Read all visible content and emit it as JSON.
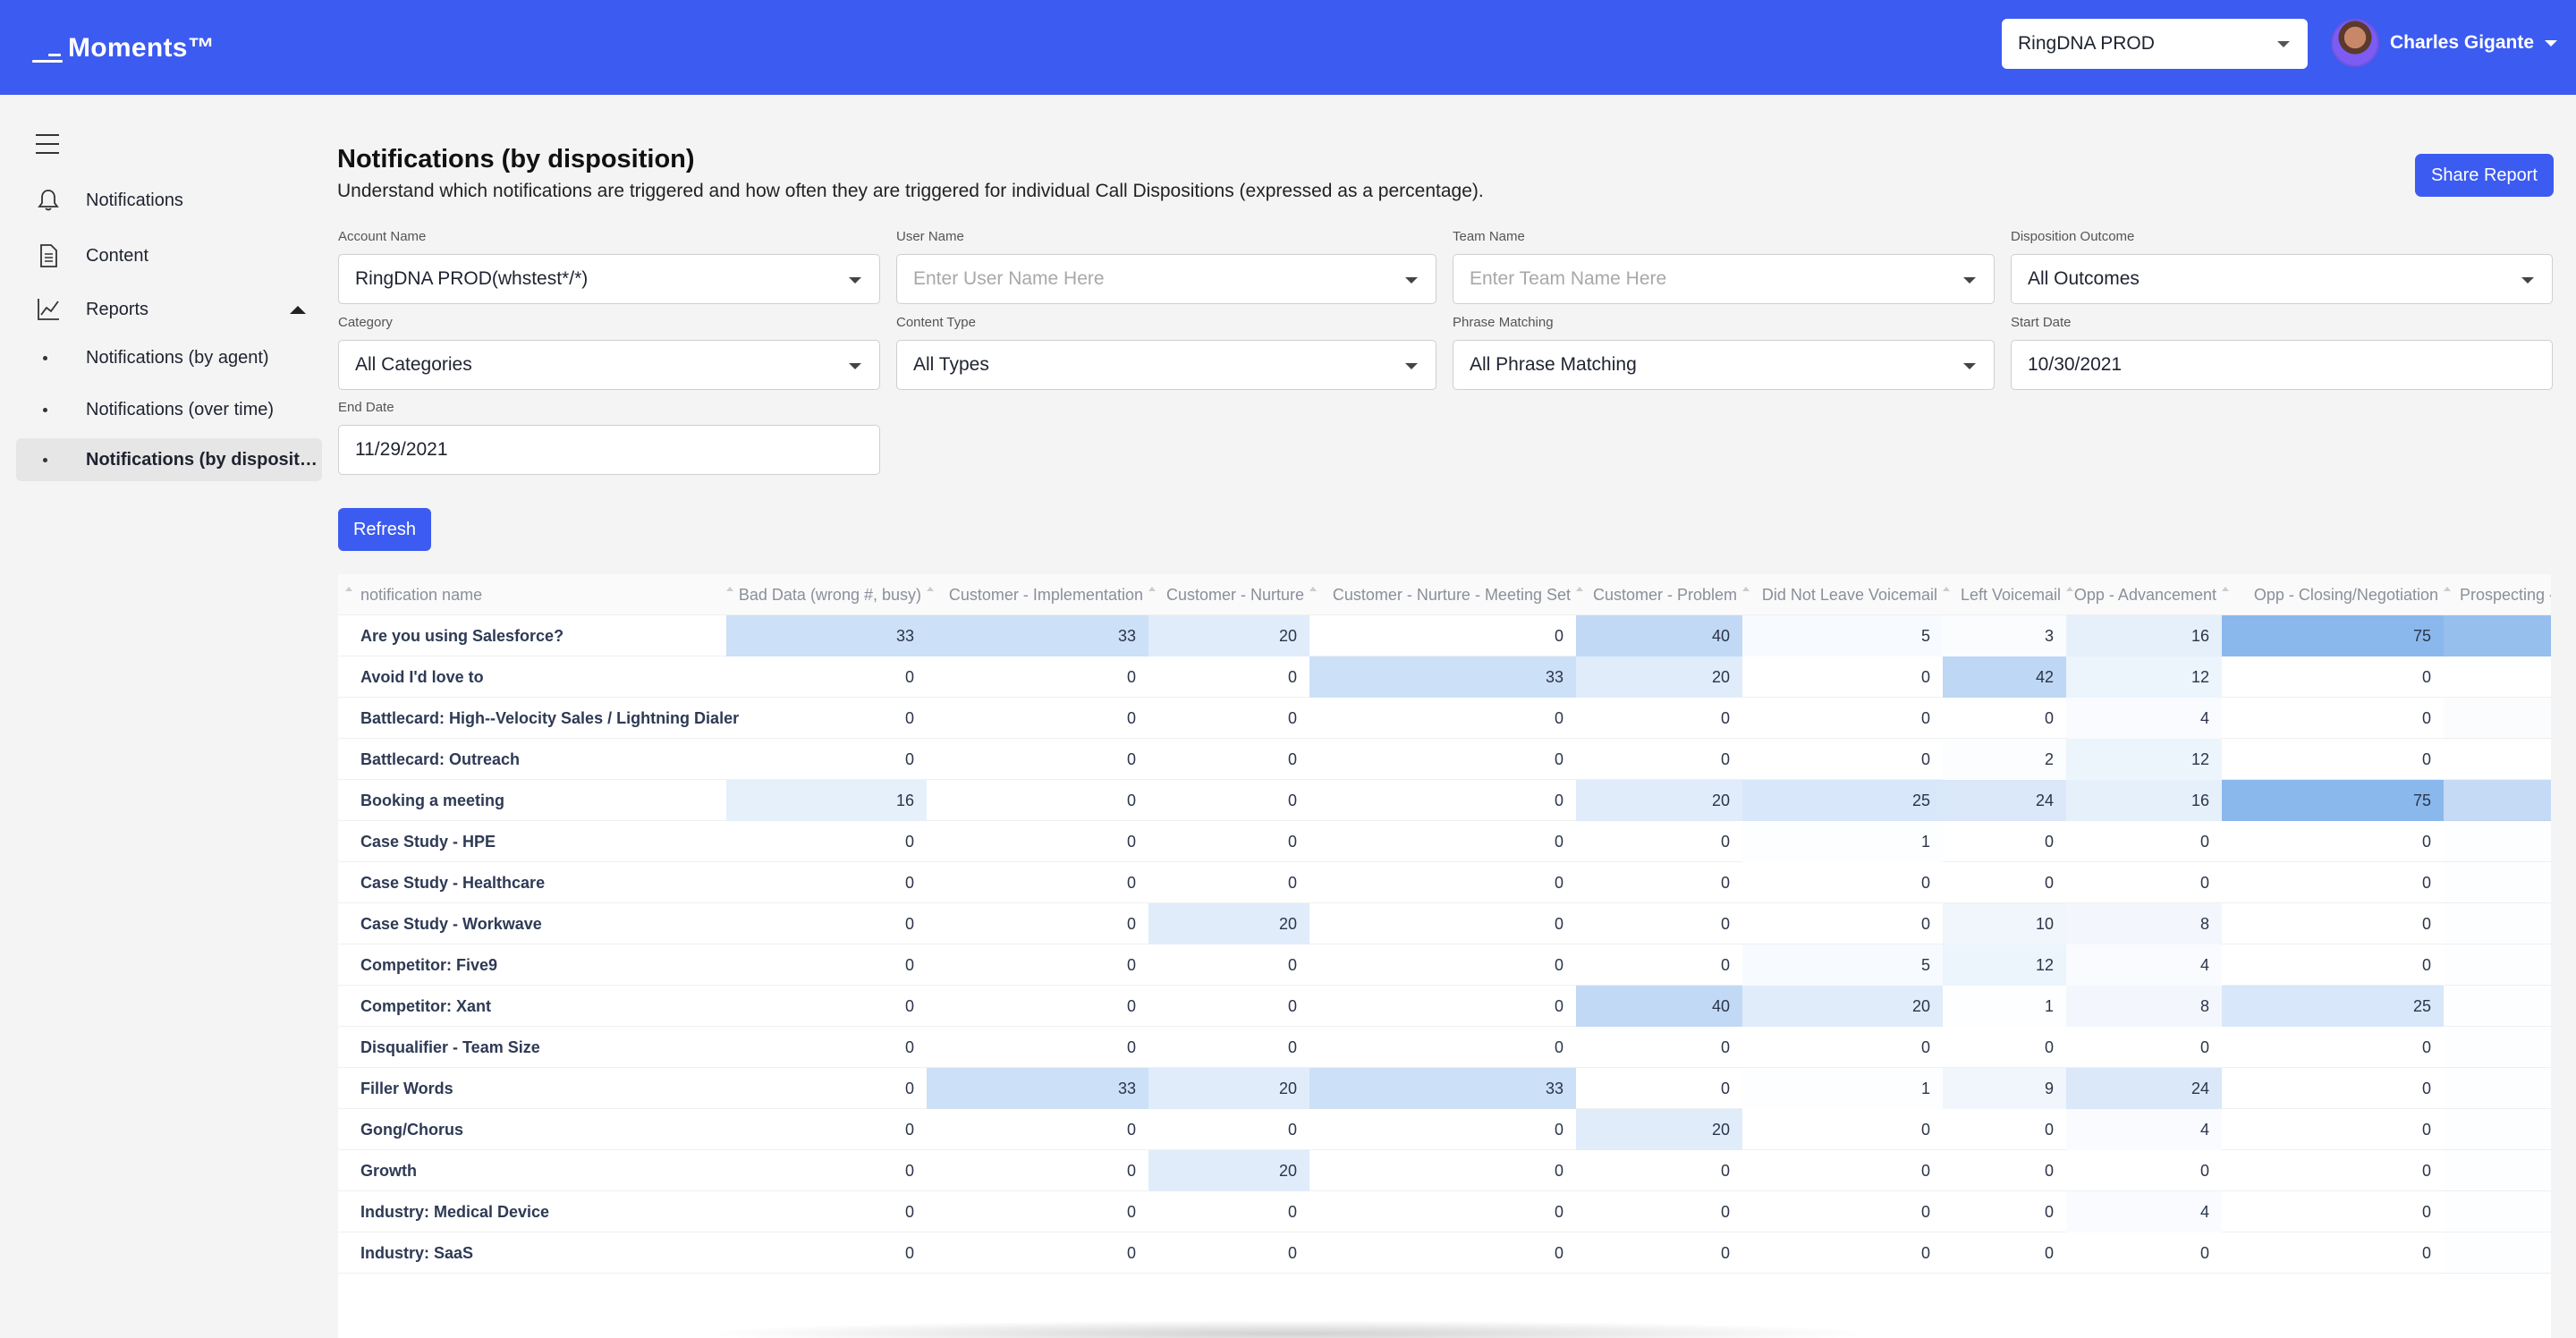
{
  "app": {
    "name": "Moments™"
  },
  "header": {
    "org_select": "RingDNA PROD",
    "user_name": "Charles Gigante"
  },
  "sidebar": {
    "items": [
      {
        "label": "Notifications",
        "icon": "bell-icon"
      },
      {
        "label": "Content",
        "icon": "document-icon"
      },
      {
        "label": "Reports",
        "icon": "chart-line-icon"
      }
    ],
    "sub_items": [
      {
        "label": "Notifications (by agent)"
      },
      {
        "label": "Notifications (over time)"
      },
      {
        "label": "Notifications (by disposition)"
      }
    ]
  },
  "page": {
    "title": "Notifications (by disposition)",
    "description": "Understand which notifications are triggered and how often they are triggered for individual Call Dispositions (expressed as a percentage).",
    "share_label": "Share Report",
    "refresh_label": "Refresh"
  },
  "filters": {
    "account_name": {
      "label": "Account Name",
      "value": "RingDNA PROD(whstest*/*)"
    },
    "user_name": {
      "label": "User Name",
      "placeholder": "Enter User Name Here"
    },
    "team_name": {
      "label": "Team Name",
      "placeholder": "Enter Team Name Here"
    },
    "disposition_outcome": {
      "label": "Disposition Outcome",
      "value": "All Outcomes"
    },
    "category": {
      "label": "Category",
      "value": "All Categories"
    },
    "content_type": {
      "label": "Content Type",
      "value": "All Types"
    },
    "phrase_matching": {
      "label": "Phrase Matching",
      "value": "All Phrase Matching"
    },
    "start_date": {
      "label": "Start Date",
      "value": "10/30/2021"
    },
    "end_date": {
      "label": "End Date",
      "value": "11/29/2021"
    }
  },
  "colors": {
    "brand": "#3c5bf0",
    "heat_max": "#8bb8ec",
    "heat_min": "#ffffff"
  },
  "table": {
    "columns": [
      "notification name",
      "Bad Data (wrong #, busy)",
      "Customer - Implementation",
      "Customer - Nurture",
      "Customer - Nurture - Meeting Set",
      "Customer - Problem",
      "Did Not Leave Voicemail",
      "Left Voicemail",
      "Opp - Advancement",
      "Opp - Closing/Negotiation",
      "Prospecting -"
    ],
    "rows": [
      {
        "name": "Are you using Salesforce?",
        "values": [
          33,
          33,
          20,
          0,
          40,
          5,
          3,
          16,
          75
        ]
      },
      {
        "name": "Avoid I'd love to",
        "values": [
          0,
          0,
          0,
          33,
          20,
          0,
          42,
          12,
          0
        ]
      },
      {
        "name": "Battlecard: High--Velocity Sales / Lightning Dialer",
        "values": [
          0,
          0,
          0,
          0,
          0,
          0,
          0,
          4,
          0
        ]
      },
      {
        "name": "Battlecard: Outreach",
        "values": [
          0,
          0,
          0,
          0,
          0,
          0,
          2,
          12,
          0
        ]
      },
      {
        "name": "Booking a meeting",
        "values": [
          16,
          0,
          0,
          0,
          20,
          25,
          24,
          16,
          75
        ]
      },
      {
        "name": "Case Study - HPE",
        "values": [
          0,
          0,
          0,
          0,
          0,
          1,
          0,
          0,
          0
        ]
      },
      {
        "name": "Case Study - Healthcare",
        "values": [
          0,
          0,
          0,
          0,
          0,
          0,
          0,
          0,
          0
        ]
      },
      {
        "name": "Case Study - Workwave",
        "values": [
          0,
          0,
          20,
          0,
          0,
          0,
          10,
          8,
          0
        ]
      },
      {
        "name": "Competitor: Five9",
        "values": [
          0,
          0,
          0,
          0,
          0,
          5,
          12,
          4,
          0
        ]
      },
      {
        "name": "Competitor: Xant",
        "values": [
          0,
          0,
          0,
          0,
          40,
          20,
          1,
          8,
          25
        ]
      },
      {
        "name": "Disqualifier - Team Size",
        "values": [
          0,
          0,
          0,
          0,
          0,
          0,
          0,
          0,
          0
        ]
      },
      {
        "name": "Filler Words",
        "values": [
          0,
          33,
          20,
          33,
          0,
          1,
          9,
          24,
          0
        ]
      },
      {
        "name": "Gong/Chorus",
        "values": [
          0,
          0,
          0,
          0,
          20,
          0,
          0,
          4,
          0
        ]
      },
      {
        "name": "Growth",
        "values": [
          0,
          0,
          20,
          0,
          0,
          0,
          0,
          0,
          0
        ]
      },
      {
        "name": "Industry: Medical Device",
        "values": [
          0,
          0,
          0,
          0,
          0,
          0,
          0,
          4,
          0
        ]
      },
      {
        "name": "Industry: SaaS",
        "values": [
          0,
          0,
          0,
          0,
          0,
          0,
          0,
          0,
          0
        ]
      }
    ],
    "last_column_heat": [
      0.9,
      0,
      0.04,
      0,
      0.5,
      0.02,
      0.02,
      0.02,
      0.02,
      0.02,
      0.02,
      0.02,
      0.02,
      0.02,
      0.02,
      0.02
    ]
  }
}
